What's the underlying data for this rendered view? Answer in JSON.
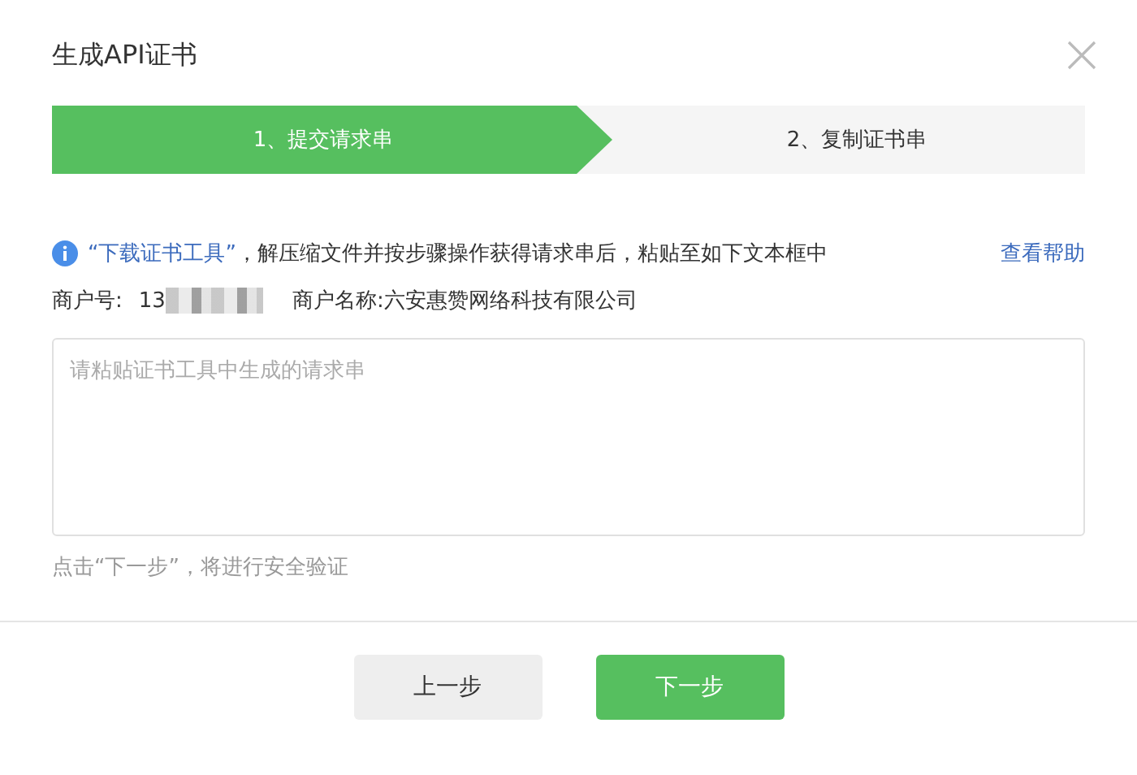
{
  "dialog": {
    "title": "生成API证书"
  },
  "steps": [
    {
      "label": "1、提交请求串",
      "selected": true
    },
    {
      "label": "2、复制证书串",
      "selected": false
    }
  ],
  "notice": {
    "link": "“下载证书工具”",
    "text": "，解压缩文件并按步骤操作获得请求串后，粘贴至如下文本框中",
    "help": "查看帮助"
  },
  "merchant": {
    "id_label": "商户号:",
    "id_value": "13",
    "name_label": "商户名称:",
    "name_value": "六安惠赞网络科技有限公司"
  },
  "request_field": {
    "placeholder": "请粘贴证书工具中生成的请求串"
  },
  "hint": "点击“下一步”，将进行安全验证",
  "buttons": [
    {
      "label": "上一步",
      "kind": "secondary"
    },
    {
      "label": "下一步",
      "kind": "primary"
    }
  ]
}
